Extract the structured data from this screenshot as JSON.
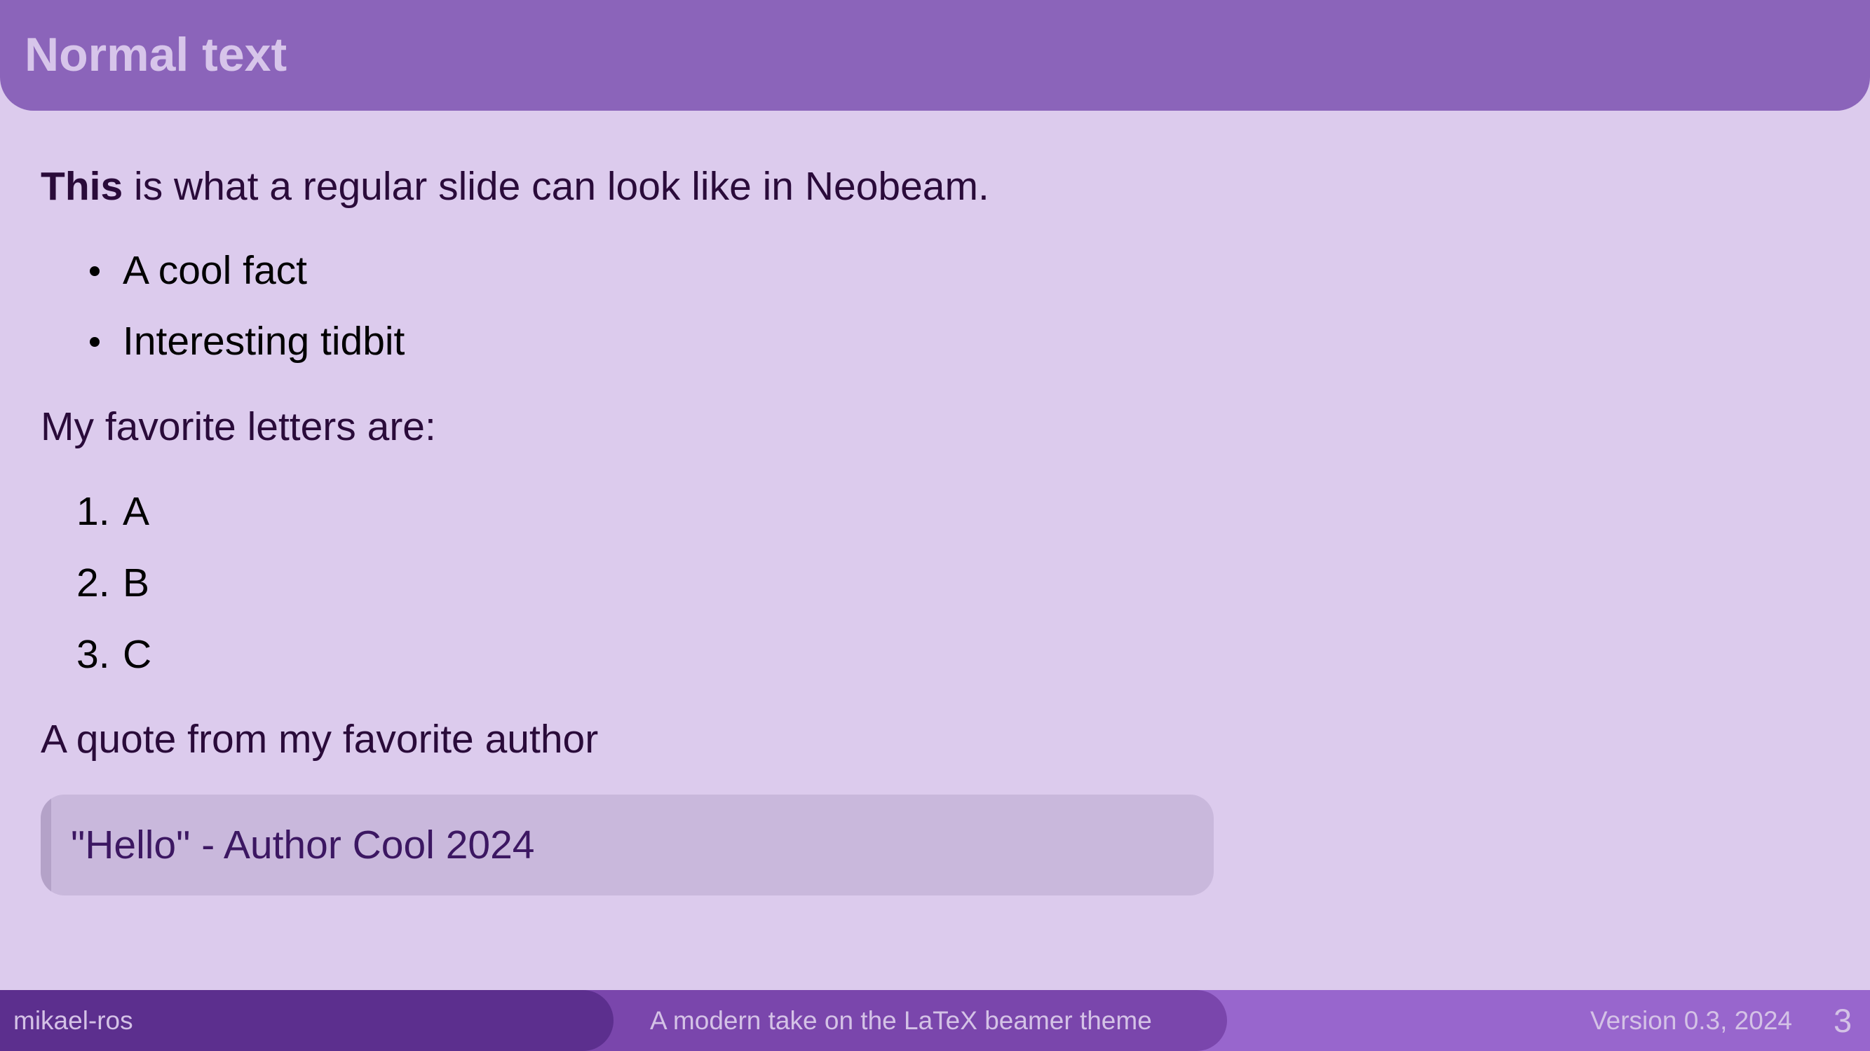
{
  "slide": {
    "title": "Normal text",
    "intro_bold": "This",
    "intro_rest": " is what a regular slide can look like in Neobeam.",
    "bullets": [
      "A cool fact",
      "Interesting tidbit"
    ],
    "letters_heading": "My favorite letters are:",
    "enumerated": [
      {
        "num": "1.",
        "text": "A"
      },
      {
        "num": "2.",
        "text": "B"
      },
      {
        "num": "3.",
        "text": "C"
      }
    ],
    "quote_heading": "A quote from my favorite author",
    "quote": "\"Hello\" - Author Cool 2024"
  },
  "footer": {
    "author": "mikael-ros",
    "subtitle": "A modern take on the LaTeX beamer theme",
    "version": "Version 0.3, 2024",
    "page_number": "3"
  },
  "colors": {
    "header": "#8b64ba",
    "background": "#dccbed",
    "footer_left": "#5c2f8e",
    "footer_mid": "#7a46ac",
    "footer_right": "#9866cd",
    "quote_box": "#c9b8dc"
  }
}
